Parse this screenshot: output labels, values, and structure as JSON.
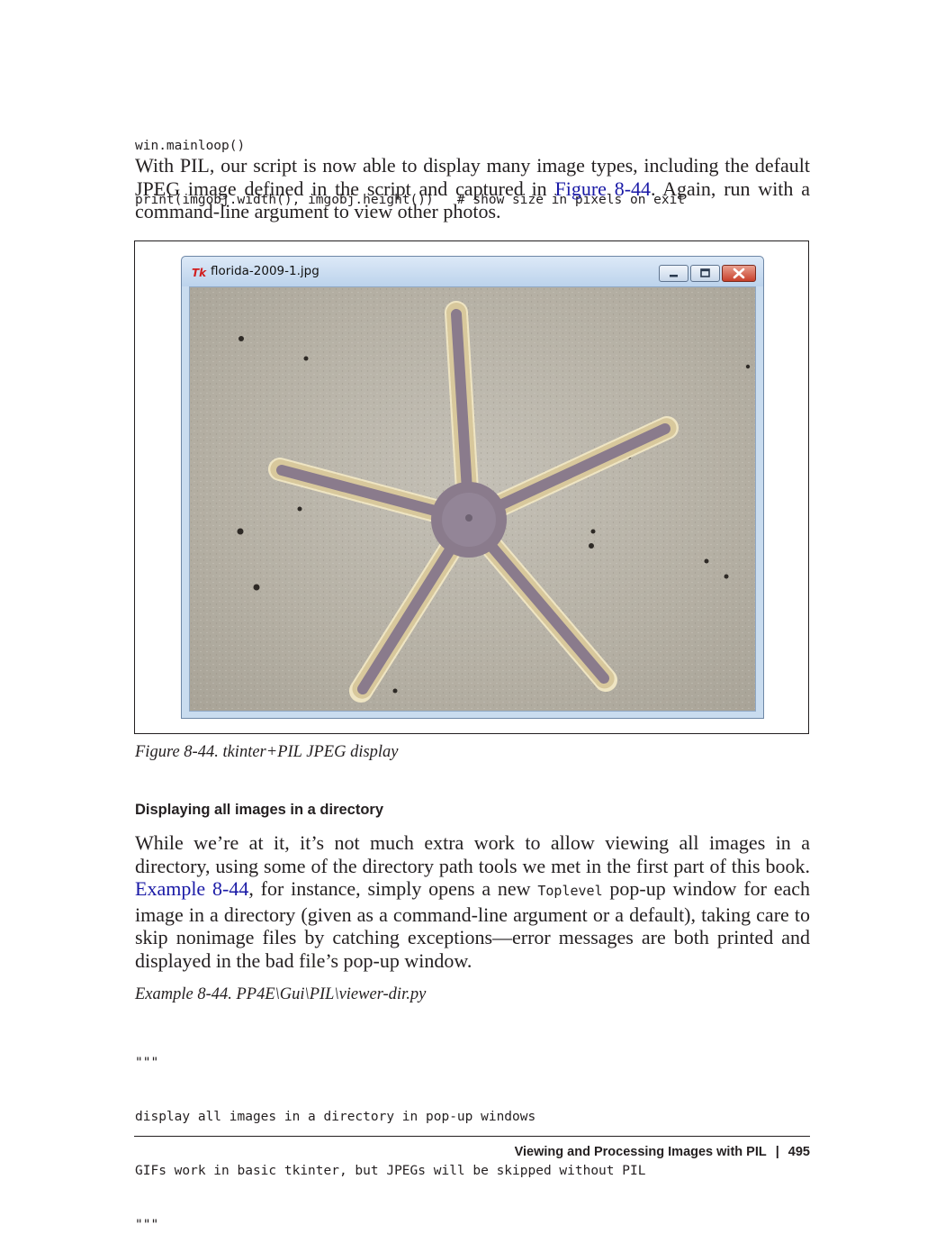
{
  "code_top": {
    "lines": [
      "win.mainloop()",
      "print(imgobj.width(), imgobj.height())   # show size in pixels on exit"
    ]
  },
  "para1": {
    "text_before_link": "With PIL, our script is now able to display many image types, including the default JPEG image defined in the script and captured in ",
    "link": "Figure 8-44",
    "text_after_link": ". Again, run with a command-line argument to view other photos."
  },
  "figure": {
    "window_title": "florida-2009-1.jpg",
    "caption": "Figure 8-44. tkinter+PIL JPEG display"
  },
  "section": {
    "heading": "Displaying all images in a directory"
  },
  "para2": {
    "t1": "While we’re at it, it’s not much extra work to allow viewing all images in a directory, using some of the directory path tools we met in the first part of this book. ",
    "link": "Example 8-44",
    "t2": ", for instance, simply opens a new ",
    "code": "Toplevel",
    "t3": " pop-up window for each image in a directory (given as a command-line argument or a default), taking care to skip nonimage files by catching exceptions—error messages are both printed and displayed in the bad file’s pop-up window."
  },
  "example": {
    "caption": "Example 8-44. PP4E\\Gui\\PIL\\viewer-dir.py",
    "lines": [
      "\"\"\"",
      "display all images in a directory in pop-up windows",
      "GIFs work in basic tkinter, but JPEGs will be skipped without PIL",
      "\"\"\""
    ]
  },
  "footer": {
    "section_title": "Viewing and Processing Images with PIL",
    "separator": "|",
    "page_number": "495"
  },
  "colors": {
    "link": "#1a1aa6",
    "text": "#231f20",
    "window_frame": "#c9dcef"
  }
}
